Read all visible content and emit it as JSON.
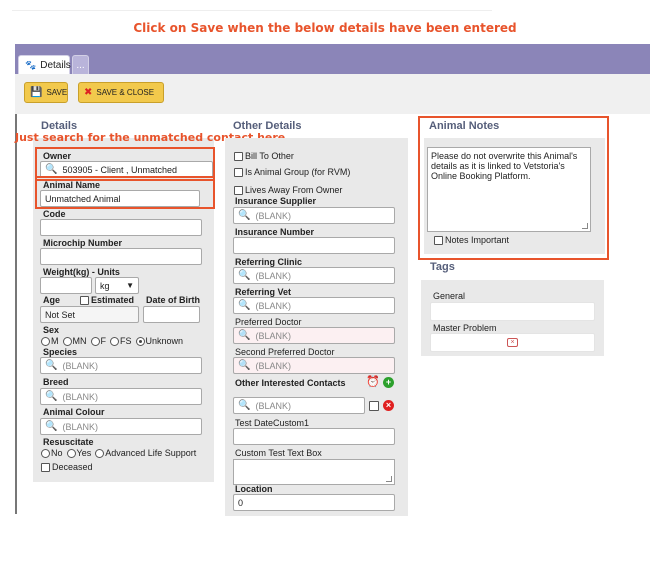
{
  "instruction": "Click on Save when the below details have been entered",
  "annotation": "Just search for the unmatched contact here",
  "tabs": {
    "details": "Details",
    "other": "..."
  },
  "toolbar": {
    "save_label": "SAVE",
    "save_close_label": "SAVE & CLOSE"
  },
  "details": {
    "title": "Details",
    "owner_label": "Owner",
    "owner_value": "503905 -  Client , Unmatched",
    "animal_name_label": "Animal Name",
    "animal_name_value": "Unmatched Animal",
    "code_label": "Code",
    "microchip_label": "Microchip Number",
    "weight_label": "Weight(kg) - Units",
    "weight_unit": "kg",
    "age_label": "Age",
    "estimated_label": "Estimated",
    "dob_label": "Date of Birth",
    "age_value": "Not Set",
    "sex_label": "Sex",
    "sex_options": [
      "M",
      "MN",
      "F",
      "FS",
      "Unknown"
    ],
    "sex_selected": "Unknown",
    "species_label": "Species",
    "breed_label": "Breed",
    "colour_label": "Animal Colour",
    "blank": "(BLANK)",
    "resuscitate_label": "Resuscitate",
    "resuscitate_options": [
      "No",
      "Yes",
      "Advanced Life Support"
    ],
    "deceased_label": "Deceased"
  },
  "other": {
    "title": "Other Details",
    "bill_to_other": "Bill To Other",
    "animal_group": "Is Animal Group (for RVM)",
    "lives_away": "Lives Away From Owner",
    "insurance_supplier_label": "Insurance Supplier",
    "insurance_number_label": "Insurance Number",
    "referring_clinic_label": "Referring Clinic",
    "referring_vet_label": "Referring Vet",
    "preferred_doctor_label": "Preferred Doctor",
    "second_doctor_label": "Second Preferred Doctor",
    "interested_contacts_label": "Other Interested Contacts",
    "test_date_label": "Test DateCustom1",
    "custom_text_label": "Custom Test Text Box",
    "location_label": "Location",
    "location_value": "0",
    "blank": "(BLANK)"
  },
  "notes": {
    "title": "Animal Notes",
    "text": "Please do not overwrite this Animal's details as it is linked to Vetstoria's Online Booking Platform.",
    "important_label": "Notes Important"
  },
  "tags": {
    "title": "Tags",
    "general_label": "General",
    "master_problem_label": "Master Problem"
  },
  "colors": {
    "accent": "#e8542c",
    "tabbar": "#8b85b8",
    "button": "#f2c94c",
    "heading": "#555e7a"
  }
}
